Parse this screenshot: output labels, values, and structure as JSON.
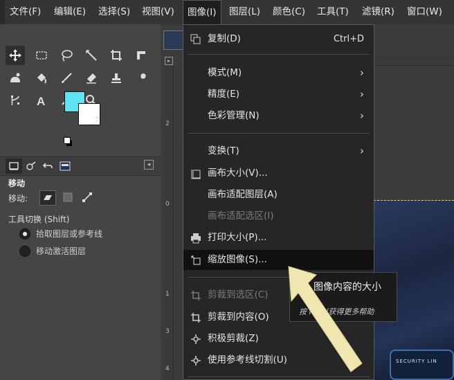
{
  "menubar": {
    "items": [
      "文件(F)",
      "编辑(E)",
      "选择(S)",
      "视图(V)",
      "图像(I)",
      "图层(L)",
      "颜色(C)",
      "工具(T)",
      "滤镜(R)",
      "窗口(W)"
    ],
    "active": "图像(I)"
  },
  "toolbox": {
    "tools": [
      "move-tool",
      "rect-select-tool",
      "lasso-tool",
      "fuzzy-select-tool",
      "crop-tool",
      "transform-tool",
      "warp-tool",
      "bucket-fill-tool",
      "paintbrush-tool",
      "eraser-tool",
      "clone-tool",
      "smudge-tool",
      "paths-tool",
      "text-tool",
      "color-picker-tool",
      "zoom-tool"
    ],
    "fg_color": "#5ee3f2",
    "bg_color": "#ffffff"
  },
  "tool_options": {
    "title": "移动",
    "move_label": "移动:",
    "switch_label": "工具切换 (Shift)",
    "radio_1": "拾取图层或参考线",
    "radio_2": "移动激活图层"
  },
  "image_menu": {
    "copy": {
      "label": "复制(D)",
      "shortcut": "Ctrl+D"
    },
    "mode": "模式(M)",
    "precision": "精度(E)",
    "color_mgmt": "色彩管理(N)",
    "transform": "变换(T)",
    "canvas_size": "画布大小(V)...",
    "fit_canvas_layers": "画布适配图层(A)",
    "fit_canvas_selection": "画布适配选区(I)",
    "print_size": "打印大小(P)...",
    "scale_image": "缩放图像(S)...",
    "crop_to_selection": "剪裁到选区(C)",
    "crop_to_content": "剪裁到内容(O)",
    "zealous_crop": "积极剪裁(Z)",
    "slice_guides": "使用参考线切割(U)"
  },
  "tooltip": {
    "main": "图像内容的大小",
    "hint": "按 F1 以获得更多帮助"
  },
  "canvas": {
    "ruler_v_0": "0",
    "ruler_v_1": "1",
    "ruler_v_2": "2",
    "ruler_v_3": "3",
    "ruler_v_4": "4",
    "badge_text": "SECURITY LIN"
  },
  "colors": {
    "accent_arrow": "#efe6b0",
    "menu_bg": "#262626",
    "selection_border": "#e8d86a"
  }
}
